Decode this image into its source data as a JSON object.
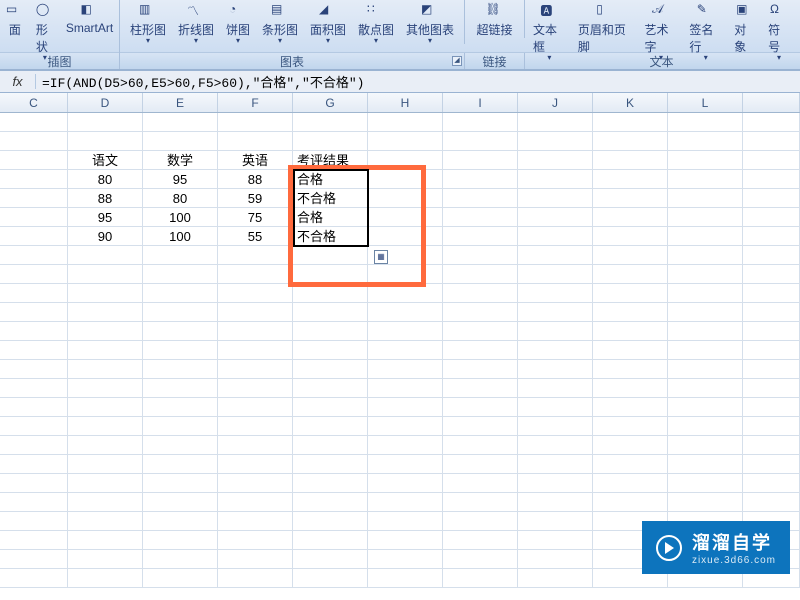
{
  "ribbon": {
    "row1": [
      {
        "label": "面",
        "dd": ""
      },
      {
        "label": "形状",
        "dd": "▾"
      },
      {
        "label": "SmartArt",
        "dd": ""
      }
    ],
    "charts": [
      {
        "label": "柱形图",
        "dd": "▾"
      },
      {
        "label": "折线图",
        "dd": "▾"
      },
      {
        "label": "饼图",
        "dd": "▾"
      },
      {
        "label": "条形图",
        "dd": "▾"
      },
      {
        "label": "面积图",
        "dd": "▾"
      },
      {
        "label": "散点图",
        "dd": "▾"
      },
      {
        "label": "其他图表",
        "dd": "▾"
      }
    ],
    "link": {
      "label": "超链接"
    },
    "text": [
      {
        "label": "文本框",
        "dd": "▾"
      },
      {
        "label": "页眉和页脚"
      },
      {
        "label": "艺术字",
        "dd": "▾"
      },
      {
        "label": "签名行",
        "dd": "▾"
      },
      {
        "label": "对象"
      },
      {
        "label": "符号",
        "dd": "▾"
      }
    ],
    "groups": {
      "g1": "插图",
      "g2": "图表",
      "g3": "链接",
      "g4": "文本"
    }
  },
  "formula_bar": {
    "fx": "fx",
    "formula": "=IF(AND(D5>60,E5>60,F5>60),\"合格\",\"不合格\")"
  },
  "columns": [
    "C",
    "D",
    "E",
    "F",
    "G",
    "H",
    "I",
    "J",
    "K",
    "L"
  ],
  "sheet": {
    "headers": {
      "D": "语文",
      "E": "数学",
      "F": "英语",
      "G": "考评结果"
    },
    "rows": [
      {
        "D": "80",
        "E": "95",
        "F": "88",
        "G": "合格"
      },
      {
        "D": "88",
        "E": "80",
        "F": "59",
        "G": "不合格"
      },
      {
        "D": "95",
        "E": "100",
        "F": "75",
        "G": "合格"
      },
      {
        "D": "90",
        "E": "100",
        "F": "55",
        "G": "不合格"
      }
    ]
  },
  "watermark": {
    "line1": "溜溜自学",
    "line2": "zixue.3d66.com"
  },
  "chart_data": {
    "type": "table",
    "title": "考评结果",
    "columns": [
      "语文",
      "数学",
      "英语",
      "考评结果"
    ],
    "rows": [
      [
        80,
        95,
        88,
        "合格"
      ],
      [
        88,
        80,
        59,
        "不合格"
      ],
      [
        95,
        100,
        75,
        "合格"
      ],
      [
        90,
        100,
        55,
        "不合格"
      ]
    ]
  }
}
